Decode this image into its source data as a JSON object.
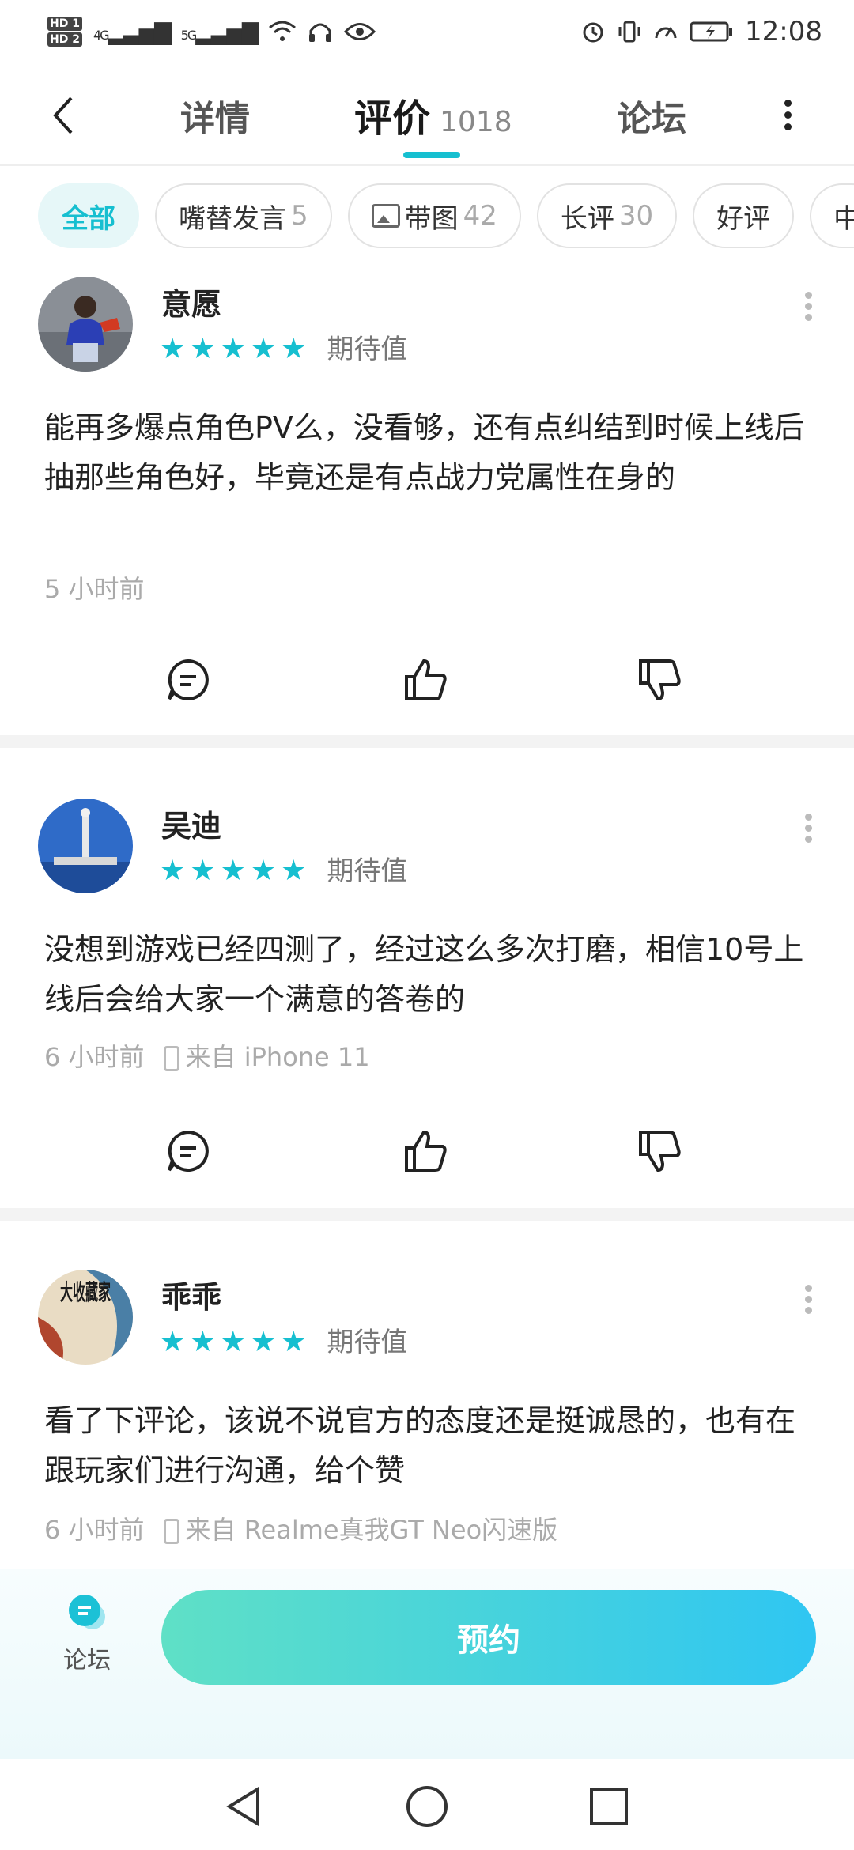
{
  "status_bar": {
    "hd1": "HD 1",
    "hd2": "HD 2",
    "net1": "4G",
    "net2": "5G",
    "time": "12:08"
  },
  "nav": {
    "tab_detail": "详情",
    "tab_review": "评价",
    "review_count": "1018",
    "tab_forum": "论坛"
  },
  "filters": [
    {
      "label": "全部",
      "count": ""
    },
    {
      "label": "嘴替发言",
      "count": "5"
    },
    {
      "label": "带图",
      "count": "42"
    },
    {
      "label": "长评",
      "count": "30"
    },
    {
      "label": "好评",
      "count": ""
    },
    {
      "label": "中",
      "count": ""
    }
  ],
  "reviews": [
    {
      "name": "意愿",
      "tag": "期待值",
      "rating": 5,
      "content": "能再多爆点角色PV么，没看够，还有点纠结到时候上线后抽那些角色好，毕竟还是有点战力党属性在身的",
      "time": "5 小时前",
      "device": ""
    },
    {
      "name": "吴迪",
      "tag": "期待值",
      "rating": 5,
      "content": "没想到游戏已经四测了，经过这么多次打磨，相信10号上线后会给大家一个满意的答卷的",
      "time": "6 小时前",
      "device": "来自 iPhone 11"
    },
    {
      "name": "乖乖",
      "tag": "期待值",
      "rating": 5,
      "content": "看了下评论，该说不说官方的态度还是挺诚恳的，也有在跟玩家们进行沟通，给个赞",
      "time": "6 小时前",
      "device": "来自 Realme真我GT Neo闪速版"
    }
  ],
  "avatar3_text": "大收藏家",
  "bottom": {
    "forum_label": "论坛",
    "reserve_label": "预约"
  },
  "colors": {
    "accent": "#16bfd0",
    "star": "#16bfd0",
    "button_start": "#5fe0c6",
    "button_end": "#2fc6f2"
  }
}
